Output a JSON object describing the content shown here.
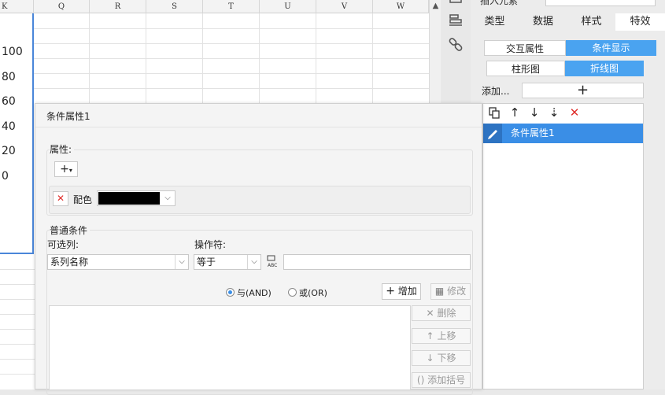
{
  "spreadsheet": {
    "columns": [
      "K",
      "Q",
      "R",
      "S",
      "T",
      "U",
      "V",
      "W"
    ],
    "y_ticks": [
      "100",
      "80",
      "60",
      "40",
      "20",
      "0"
    ]
  },
  "right_panel": {
    "cut_text": "插入元素",
    "tabs": [
      "类型",
      "数据",
      "样式",
      "特效"
    ],
    "active_tab": "特效",
    "attr_toggle": {
      "left": "交互属性",
      "right": "条件显示",
      "selected": "条件显示"
    },
    "chart_toggle": {
      "left": "柱形图",
      "right": "折线图",
      "selected": "折线图"
    },
    "add_label": "添加...",
    "add_icon": "plus-icon",
    "list_items": [
      "条件属性1"
    ],
    "selected_color": "#3a8ee6"
  },
  "dialog": {
    "title": "条件属性1",
    "properties": {
      "label": "属性:",
      "color_label": "配色",
      "color_value": "#000000"
    },
    "conditions": {
      "label": "普通条件",
      "column_label": "可选列:",
      "column_value": "系列名称",
      "operator_label": "操作符:",
      "operator_value": "等于",
      "value_input": "",
      "and_label": "与(AND)",
      "or_label": "或(OR)",
      "logic_selected": "AND",
      "add_button": "增加",
      "modify_button": "修改",
      "delete_button": "删除",
      "up_button": "上移",
      "down_button": "下移",
      "bracket_button": "添加括号"
    }
  }
}
